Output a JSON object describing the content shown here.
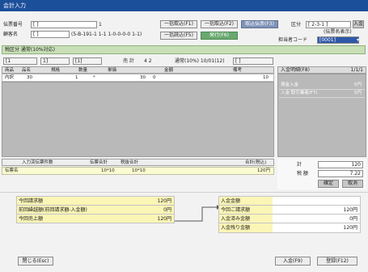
{
  "window": {
    "title": "会計入力"
  },
  "top": {
    "row1_label": "伝票番号",
    "row1_value": "[              ]",
    "row1_mid": "1",
    "row2_label": "顧客名",
    "row2_value": "[              ]",
    "row2_mid": "(5-B-191-1 1-1 1-0-0-0-0 1-1)"
  },
  "buttons": {
    "b1": "一括取込(F1)",
    "b2": "一括取込(F2)",
    "b3": "取込伝票(F3)",
    "b4": "一括読込(F5)",
    "b5": "発行(F6)"
  },
  "right_top": {
    "label": "区分",
    "value": "[ 2-3-1 ]",
    "badge": "入金",
    "sub": "(伝票名表示)",
    "select_label": "担当者コード",
    "select_value": "[0001]"
  },
  "green_bar": "税区分 通常(10%対応)",
  "info_row": {
    "a": "[1",
    "b": "1]",
    "c": "[1]",
    "d": "売 計",
    "e": "4 2",
    "f": "通常(10%) 10/01(12)",
    "g": "[               ]"
  },
  "grid": {
    "headers": [
      "商品",
      "品名",
      "規格",
      "数量",
      "単価",
      "金額",
      "備考"
    ],
    "rows": [
      [
        "内訳",
        "30",
        "",
        "1",
        "*",
        "30",
        "0",
        "10"
      ]
    ]
  },
  "right_panel": {
    "tabs": [
      "入金明細(F8)",
      "1/1/1"
    ],
    "rows": [
      {
        "k": "現金入金",
        "v": "0円"
      },
      {
        "k": "入金 取引業者(F7)",
        "v": "0円"
      }
    ]
  },
  "footer_grid": {
    "headers": [
      "入力済伝票件数",
      "伝票合計",
      "税抜合計",
      "合計(税込)"
    ],
    "row": [
      "伝票名",
      "10*10",
      "10*10",
      "120円"
    ]
  },
  "right_totals": {
    "r1_label": "計",
    "r1_value": "120",
    "r2_label": "税 額",
    "r2_value": "7.22",
    "btn_a": "確定",
    "btn_b": "取消"
  },
  "bottom_left": [
    {
      "label": "今回請求額",
      "value": "120円"
    },
    {
      "label": "前回繰越額(前回請求額-入金額)",
      "value": "0円"
    },
    {
      "label": "今回売上額",
      "value": "120円"
    }
  ],
  "bottom_right": {
    "title": "入金金額",
    "rows": [
      {
        "label": "今回ご請求額",
        "value": "120円"
      },
      {
        "label": "入金済み金額",
        "value": "0円"
      },
      {
        "label": "入金残り金額",
        "value": "120円"
      }
    ]
  },
  "bottom_buttons": {
    "left": "閉じる(Esc)",
    "right1": "入金(F9)",
    "right2": "登録(F12)"
  }
}
